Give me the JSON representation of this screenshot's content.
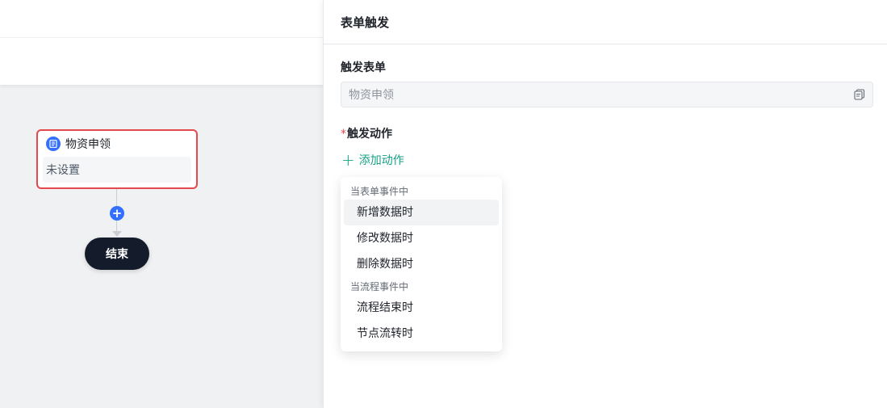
{
  "canvas": {
    "node": {
      "title": "物资申领",
      "status": "未设置"
    },
    "add_symbol": "+",
    "end_label": "结束"
  },
  "panel": {
    "title": "表单触发",
    "form_section_label": "触发表单",
    "form_select_value": "物资申领",
    "action_section_required": "*",
    "action_section_label": "触发动作",
    "add_action_label": "添加动作",
    "dropdown": {
      "groups": [
        {
          "title": "当表单事件中",
          "items": [
            "新增数据时",
            "修改数据时",
            "删除数据时"
          ]
        },
        {
          "title": "当流程事件中",
          "items": [
            "流程结束时",
            "节点流转时"
          ]
        }
      ],
      "active_item": "新增数据时"
    }
  },
  "colors": {
    "accent": "#3370ff",
    "error": "#e5484d",
    "link": "#14a085",
    "end_node": "#141c2c"
  }
}
